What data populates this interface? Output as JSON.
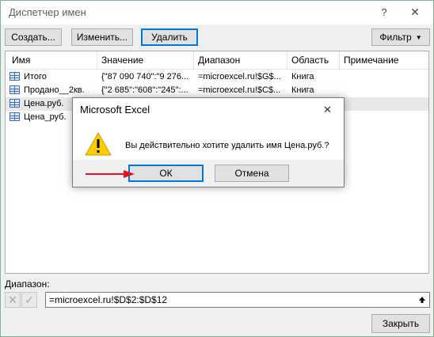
{
  "window": {
    "title": "Диспетчер имен",
    "help_icon": "question-mark",
    "close_icon": "close-x"
  },
  "toolbar": {
    "create_label": "Создать...",
    "edit_label": "Изменить...",
    "delete_label": "Удалить",
    "filter_label": "Фильтр",
    "filter_icon": "dropdown-triangle"
  },
  "table": {
    "columns": [
      "Имя",
      "Значение",
      "Диапазон",
      "Область",
      "Примечание"
    ],
    "rows": [
      {
        "name": "Итого",
        "value": "{\"87 090 740\":\"9 276...",
        "range": "=microexcel.ru!$G$...",
        "scope": "Книга",
        "note": ""
      },
      {
        "name": "Продано__2кв.",
        "value": "{\"2 685\":\"608\":\"245\":...",
        "range": "=microexcel.ru!$C$...",
        "scope": "Книга",
        "note": ""
      },
      {
        "name": "Цена.руб.",
        "value": "",
        "range": "",
        "scope": "",
        "note": ""
      },
      {
        "name": "Цена_руб.",
        "value": "",
        "range": "",
        "scope": "",
        "note": ""
      }
    ]
  },
  "range": {
    "label": "Диапазон:",
    "value": "=microexcel.ru!$D$2:$D$12",
    "cancel_icon": "x-mark",
    "confirm_icon": "check-mark",
    "collapse_icon": "collapse-up"
  },
  "footer": {
    "close_label": "Закрыть"
  },
  "dialog": {
    "title": "Microsoft Excel",
    "message": "Вы действительно хотите удалить имя Цена.руб.?",
    "ok_label": "ОК",
    "cancel_label": "Отмена",
    "icon": "warning-triangle"
  },
  "colors": {
    "accent": "#0078d7",
    "warning": "#ffcc00",
    "arrow": "#e81123",
    "border_green": "#7ab68e"
  }
}
